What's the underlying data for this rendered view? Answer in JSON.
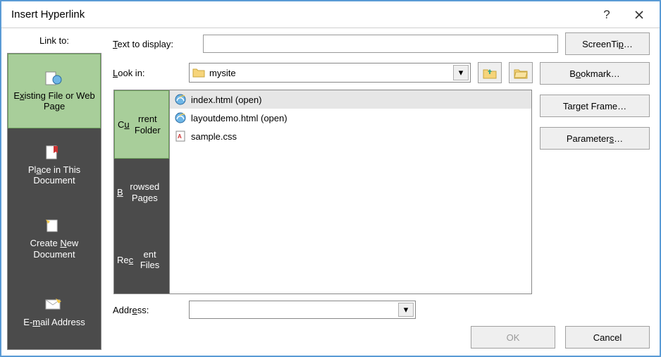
{
  "window": {
    "title": "Insert Hyperlink"
  },
  "labels": {
    "link_to": "Link to:",
    "text_to_display": "Text to display:",
    "look_in": "Look in:",
    "address": "Address:"
  },
  "link_to_items": [
    {
      "label_html": "E<span class='u'>x</span>isting File or Web Page",
      "selected": true,
      "icon": "globe-page"
    },
    {
      "label_html": "Pl<span class='u'>a</span>ce in This Document",
      "selected": false,
      "icon": "page-bookmark"
    },
    {
      "label_html": "Create <span class='u'>N</span>ew Document",
      "selected": false,
      "icon": "new-page"
    },
    {
      "label_html": "E-<span class='u'>m</span>ail Address",
      "selected": false,
      "icon": "mail"
    }
  ],
  "text_to_display_value": "",
  "look_in_folder": "mysite",
  "tabs": [
    {
      "label_html": "C<span class='u'>u</span>rrent Folder",
      "selected": true
    },
    {
      "label_html": "<span class='u'>B</span>rowsed Pages",
      "selected": false
    },
    {
      "label_html": "Re<span class='u'>c</span>ent Files",
      "selected": false
    }
  ],
  "files": [
    {
      "name": "index.html (open)",
      "icon": "ie",
      "selected": true
    },
    {
      "name": "layoutdemo.html (open)",
      "icon": "ie",
      "selected": false
    },
    {
      "name": "sample.css",
      "icon": "css",
      "selected": false
    }
  ],
  "address_value": "",
  "buttons": {
    "screentip": "ScreenTip…",
    "bookmark": "Bookmark…",
    "target_frame": "Target Frame…",
    "parameters": "Parameters…",
    "ok": "OK",
    "cancel": "Cancel"
  },
  "ok_enabled": false
}
